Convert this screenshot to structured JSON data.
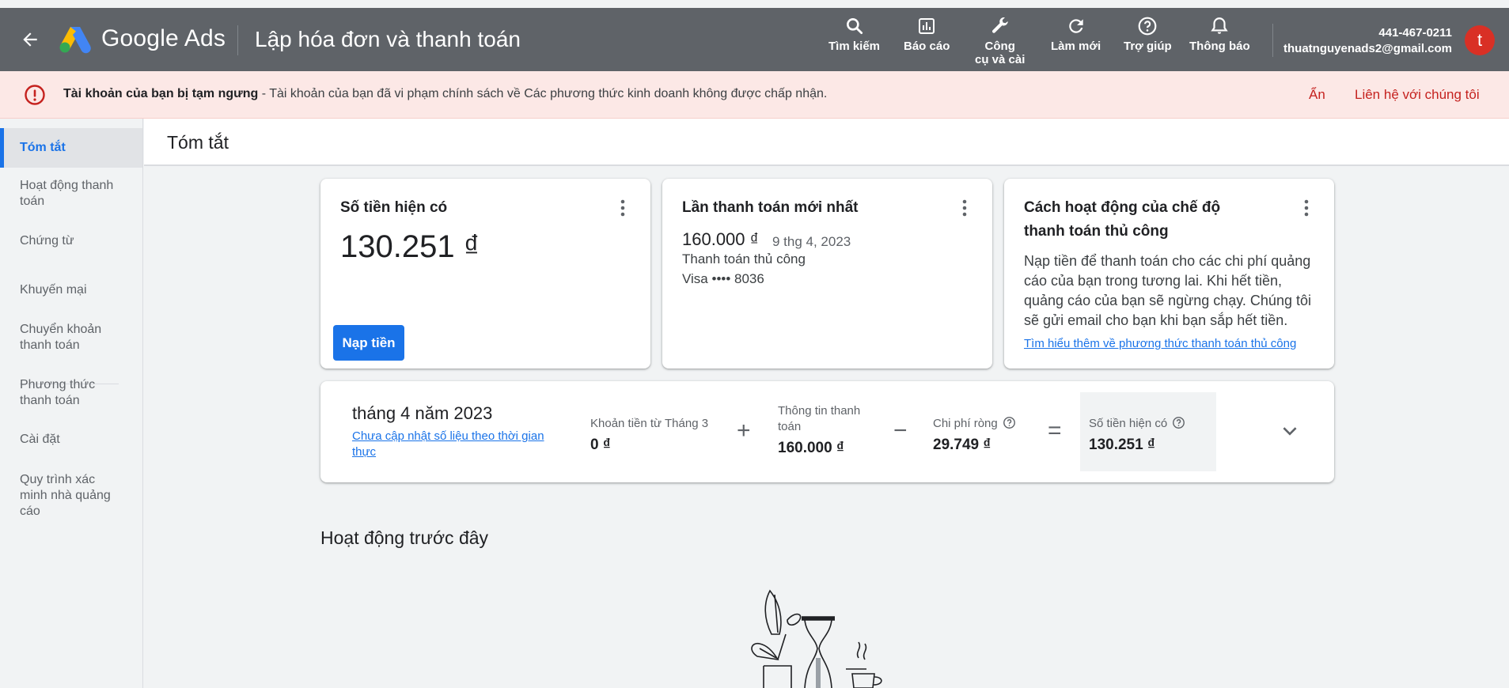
{
  "header": {
    "brand": "Google Ads",
    "page_title": "Lập hóa đơn và thanh toán",
    "tools": [
      {
        "icon": "search-icon",
        "label": "Tìm kiếm"
      },
      {
        "icon": "reports-icon",
        "label": "Báo cáo"
      },
      {
        "icon": "wrench-icon",
        "label_line1": "Công",
        "label_line2": "cụ và cài"
      },
      {
        "icon": "refresh-icon",
        "label": "Làm mới"
      },
      {
        "icon": "help-icon",
        "label": "Trợ giúp"
      },
      {
        "icon": "bell-icon",
        "label": "Thông báo"
      }
    ],
    "account_id": "441-467-0211",
    "account_email": "thuatnguyenads2@gmail.com",
    "avatar_letter": "t"
  },
  "alert": {
    "bold_text": "Tài khoản của bạn bị tạm ngưng",
    "text": " - Tài khoản của bạn đã vi phạm chính sách về Các phương thức kinh doanh không được chấp nhận.",
    "hide_label": "Ẩn",
    "contact_label": "Liên hệ với chúng tôi"
  },
  "sidebar": {
    "items": [
      {
        "label": "Tóm tắt",
        "active": true
      },
      {
        "label": "Hoạt động thanh toán"
      },
      {
        "label": "Chứng từ"
      },
      {
        "label": "Khuyến mại"
      },
      {
        "label": "Chuyển khoản thanh toán"
      },
      {
        "label": "Phương thức thanh toán"
      },
      {
        "label": "Cài đặt"
      },
      {
        "label": "Quy trình xác minh nhà quảng cáo"
      }
    ]
  },
  "main": {
    "title": "Tóm tắt",
    "balance_card": {
      "title": "Số tiền hiện có",
      "amount": "130.251 ₫",
      "button": "Nạp tiền"
    },
    "last_payment_card": {
      "title": "Lần thanh toán mới nhất",
      "amount": "160.000 ₫",
      "date": "9 thg 4, 2023",
      "method": "Thanh toán thủ công",
      "card": "Visa •••• 8036"
    },
    "manual_card": {
      "title_line1": "Cách hoạt động của chế độ",
      "title_line2": "thanh toán thủ công",
      "description": "Nạp tiền để thanh toán cho các chi phí quảng cáo của bạn trong tương lai. Khi hết tiền, quảng cáo của bạn sẽ ngừng chạy. Chúng tôi sẽ gửi email cho bạn khi bạn sắp hết tiền.",
      "link": "Tìm hiểu thêm về phương thức thanh toán thủ công"
    },
    "summary": {
      "month": "tháng 4 năm 2023",
      "note": "Chưa cập nhật số liệu theo thời gian thực",
      "carry_label": "Khoản tiền từ Tháng 3",
      "carry_value": "0 ₫",
      "payments_label": "Thông tin thanh toán",
      "payments_value": "160.000 ₫",
      "net_cost_label": "Chi phí ròng",
      "net_cost_value": "29.749 ₫",
      "balance_label": "Số tiền hiện có",
      "balance_value": "130.251 ₫",
      "op_plus": "+",
      "op_minus": "−",
      "op_equals": "="
    },
    "previous_activity_title": "Hoạt động trước đây"
  },
  "colors": {
    "header_bg": "#5f6368",
    "accent": "#1a73e8",
    "alert_bg": "#fce8e6",
    "alert_text": "#c5221f"
  }
}
